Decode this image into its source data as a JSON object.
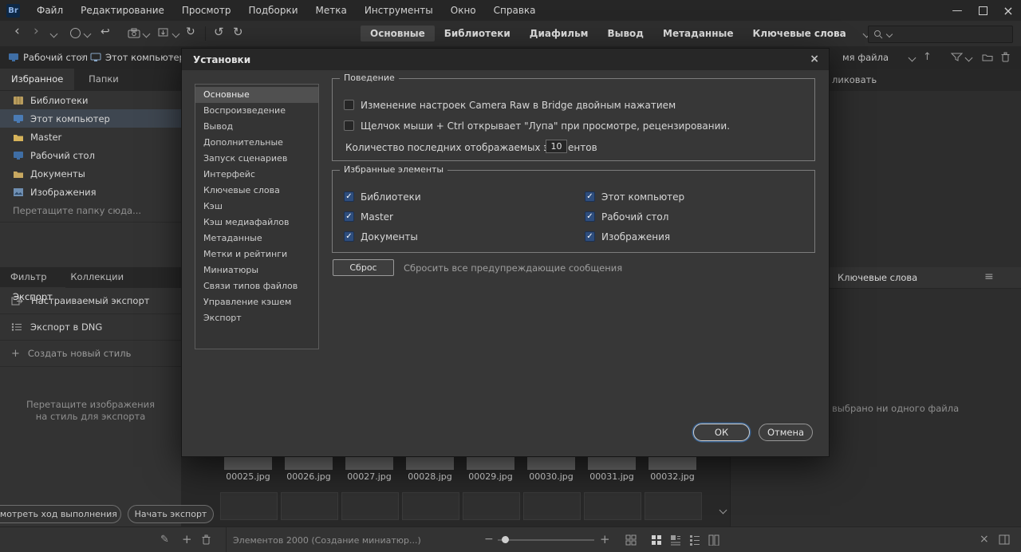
{
  "icons": {
    "back": "‹",
    "forward": "›",
    "crumb_sep": "›",
    "return": "↩",
    "rotate_ccw": "↺",
    "rotate_cw": "↻",
    "refresh": "↻",
    "minimize": "—",
    "close": "×",
    "plus": "+",
    "minus": "−",
    "pencil": "✎",
    "hamburger": "≡",
    "check": "✓",
    "up_arrow": "↑"
  },
  "titlebar": {
    "logo": "Br",
    "menus": [
      "Файл",
      "Редактирование",
      "Просмотр",
      "Подборки",
      "Метка",
      "Инструменты",
      "Окно",
      "Справка"
    ]
  },
  "toolbar": {
    "tabs": [
      "Основные",
      "Библиотеки",
      "Диафильм",
      "Вывод",
      "Метаданные",
      "Ключевые слова"
    ]
  },
  "pathbar": {
    "crumbs": [
      "Рабочий стол",
      "Этот компьютер"
    ],
    "sort_partial": "мя файла"
  },
  "left": {
    "panel_tabs": [
      "Избранное",
      "Папки"
    ],
    "favorites": [
      "Библиотеки",
      "Этот компьютер",
      "Master",
      "Рабочий стол",
      "Документы",
      "Изображения"
    ],
    "drop_hint": "Перетащите папку сюда...",
    "bottom_tabs": [
      "Фильтр",
      "Коллекции",
      "Экспорт"
    ],
    "export_items": [
      "Настраиваемый экспорт",
      "Экспорт в DNG",
      "Создать новый стиль"
    ],
    "hint1": "Перетащите изображения",
    "hint2": "на стиль для экспорта",
    "progress_btn": "осмотреть ход выполнения",
    "start_btn": "Начать экспорт"
  },
  "dialog": {
    "title": "Установки",
    "categories": [
      "Основные",
      "Воспроизведение",
      "Вывод",
      "Дополнительные",
      "Запуск сценариев",
      "Интерфейс",
      "Ключевые слова",
      "Кэш",
      "Кэш медиафайлов",
      "Метаданные",
      "Метки и рейтинги",
      "Миниатюры",
      "Связи типов файлов",
      "Управление кэшем",
      "Экспорт"
    ],
    "behavior": {
      "legend": "Поведение",
      "cb1": "Изменение настроек Camera Raw в Bridge двойным нажатием",
      "cb2": "Щелчок мыши + Ctrl открывает \"Лупа\" при просмотре, рецензировании.",
      "recent_label": "Количество последних отображаемых элементов",
      "recent_value": "10"
    },
    "favorites": {
      "legend": "Избранные элементы",
      "col1": [
        "Библиотеки",
        "Master",
        "Документы"
      ],
      "col2": [
        "Этот компьютер",
        "Рабочий стол",
        "Изображения"
      ]
    },
    "reset_btn": "Сброс",
    "reset_text": "Сбросить все предупреждающие сообщения",
    "ok": "ОК",
    "cancel": "Отмена"
  },
  "content": {
    "files": [
      "00025.jpg",
      "00026.jpg",
      "00027.jpg",
      "00028.jpg",
      "00029.jpg",
      "00030.jpg",
      "00031.jpg",
      "00032.jpg"
    ]
  },
  "right": {
    "publish_partial": "ликовать",
    "keywords_title": "Ключевые слова",
    "empty_text": "выбрано ни одного файла"
  },
  "status": {
    "items_text": "Элементов 2000 (Создание миниатюр...)"
  }
}
